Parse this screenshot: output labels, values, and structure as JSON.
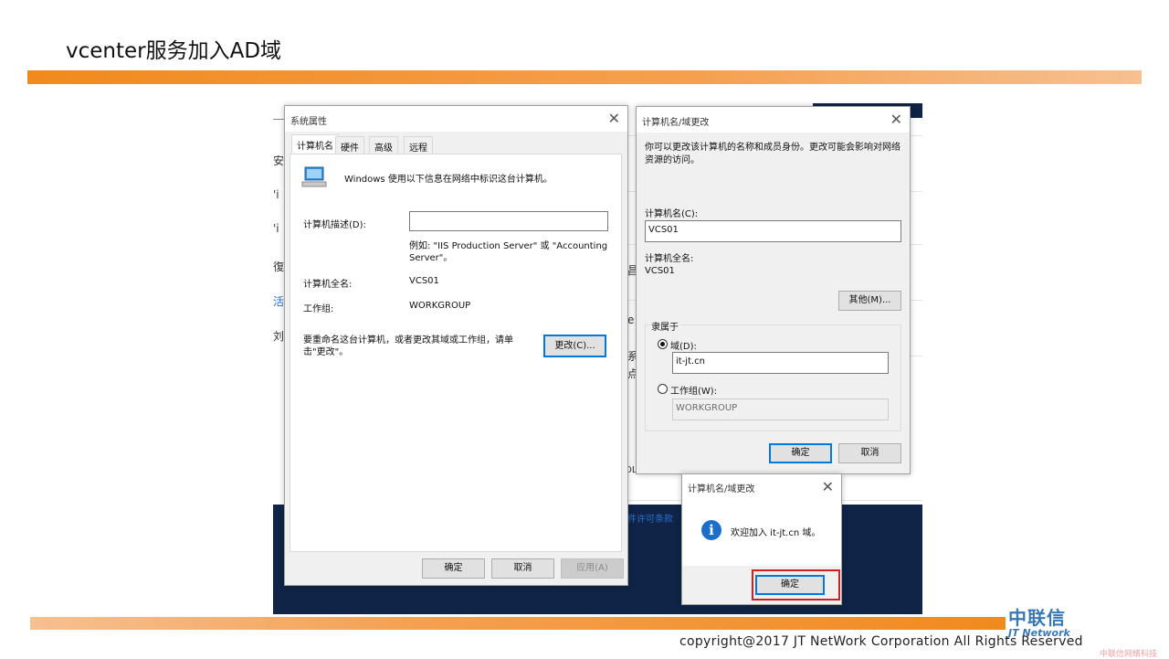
{
  "slide": {
    "title": "vcenter服务加入AD域",
    "copyright": "copyright@2017  JT NetWork Corporation All Rights Reserved",
    "logo_cn": "中联信",
    "logo_en": "JT Network",
    "watermark": "中联信网络科技"
  },
  "background": {
    "stubs": [
      "安",
      "'i",
      "'i",
      "復",
      "活",
      "刘",
      "昌",
      "e",
      "系",
      "点",
      "OL",
      "件许可条款"
    ]
  },
  "sys_props": {
    "title": "系统属性",
    "tabs": [
      "计算机名",
      "硬件",
      "高级",
      "远程"
    ],
    "intro": "Windows 使用以下信息在网络中标识这台计算机。",
    "desc_label": "计算机描述(D):",
    "desc_value": "",
    "example": "例如: \"IIS Production Server\" 或 \"Accounting Server\"。",
    "fullname_label": "计算机全名:",
    "fullname_value": "VCS01",
    "workgroup_label": "工作组:",
    "workgroup_value": "WORKGROUP",
    "rename_text": "要重命名这台计算机，或者更改其域或工作组，请单击\"更改\"。",
    "change_btn": "更改(C)...",
    "ok": "确定",
    "cancel": "取消",
    "apply": "应用(A)"
  },
  "domain_change": {
    "title": "计算机名/域更改",
    "intro": "你可以更改该计算机的名称和成员身份。更改可能会影响对网络资源的访问。",
    "name_label": "计算机名(C):",
    "name_value": "VCS01",
    "fullname_label": "计算机全名:",
    "fullname_value": "VCS01",
    "other_btn": "其他(M)...",
    "member_label": "隶属于",
    "domain_label": "域(D):",
    "domain_value": "it-jt.cn",
    "workgroup_label": "工作组(W):",
    "workgroup_value": "WORKGROUP",
    "ok": "确定",
    "cancel": "取消"
  },
  "welcome": {
    "title": "计算机名/域更改",
    "message": "欢迎加入 it-jt.cn 域。",
    "ok": "确定"
  },
  "colors": {
    "accent_orange": "#f08a1e",
    "windows_blue": "#0078d7",
    "highlight_red": "#d01f1f"
  }
}
